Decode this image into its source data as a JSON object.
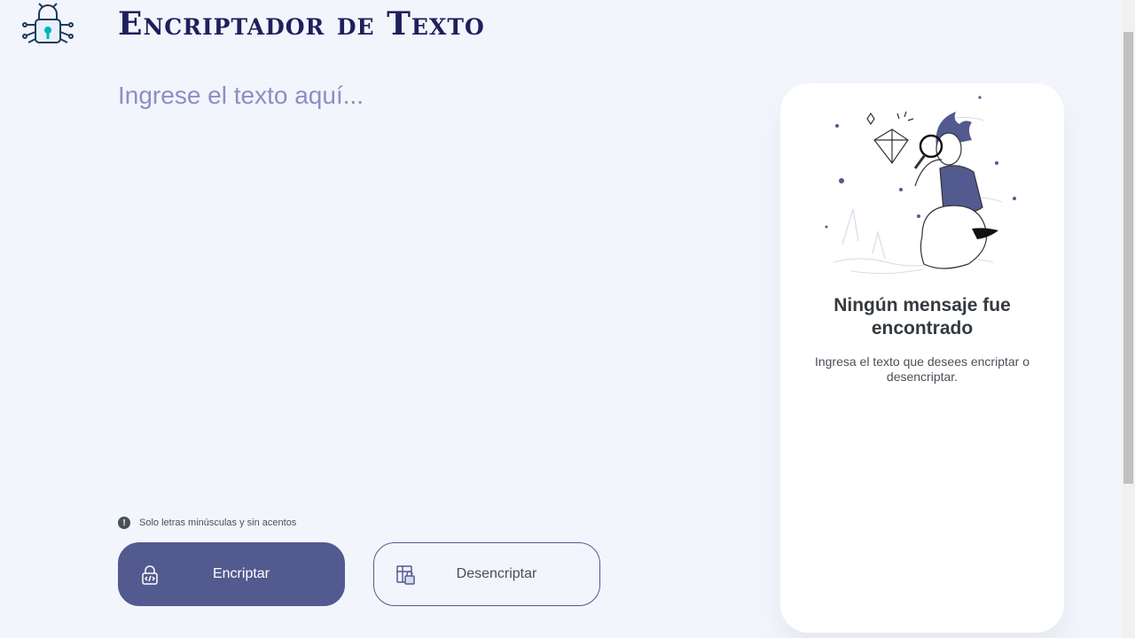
{
  "header": {
    "title": "Encriptador de Texto",
    "logo_icon": "circuit-lock-icon"
  },
  "input": {
    "placeholder": "Ingrese el texto aquí...",
    "value": ""
  },
  "hint": {
    "icon": "exclamation-circle-icon",
    "text": "Solo letras minúsculas y sin acentos"
  },
  "buttons": {
    "encrypt": {
      "label": "Encriptar",
      "icon": "lock-code-icon"
    },
    "decrypt": {
      "label": "Desencriptar",
      "icon": "unlock-grid-icon"
    }
  },
  "output": {
    "illustration": "person-with-magnifier-illustration",
    "title": "Ningún mensaje fue encontrado",
    "subtitle": "Ingresa el texto que desees encriptar o desencriptar."
  },
  "colors": {
    "background": "#f2f5fc",
    "title": "#1f1f5c",
    "accent": "#535a8f",
    "placeholder": "#8b8fc2",
    "panel": "#ffffff"
  }
}
